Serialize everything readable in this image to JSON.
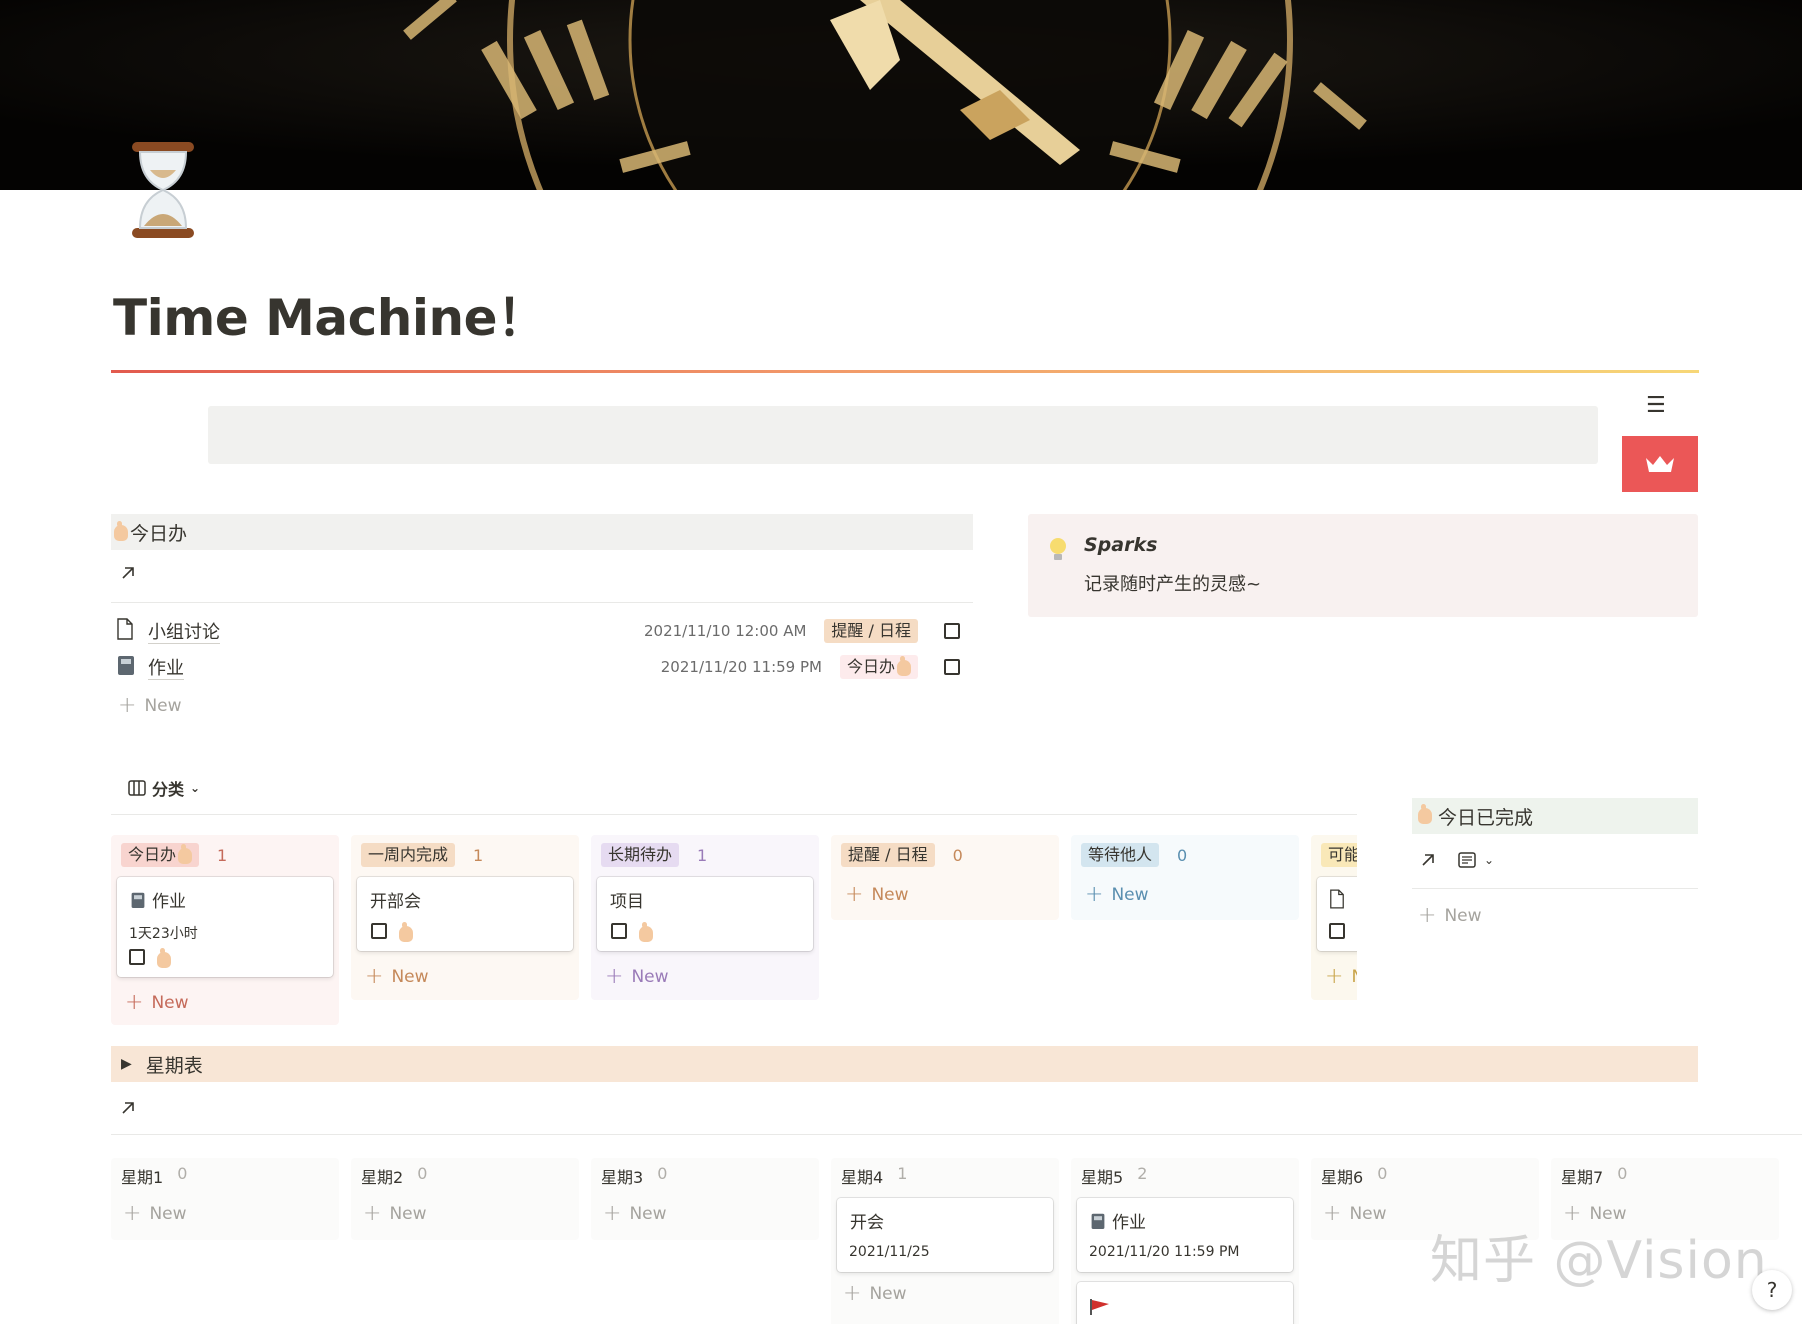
{
  "page": {
    "title": "Time Machine！"
  },
  "today_section": {
    "heading": "今日办",
    "rows": [
      {
        "title": "小组讨论",
        "date": "2021/11/10 12:00 AM",
        "tag": "提醒 / 日程"
      },
      {
        "title": "作业",
        "date": "2021/11/20 11:59 PM",
        "tag": "今日办"
      }
    ],
    "new_label": "New"
  },
  "callout": {
    "title": "Sparks",
    "text": "记录随时产生的灵感~"
  },
  "board": {
    "group_by_label": "分类",
    "columns": [
      {
        "label": "今日办",
        "count": "1",
        "color": "#fdebec",
        "tag_bg": "#f8d4cf",
        "card": {
          "title": "作业",
          "subtitle": "1天23小时"
        }
      },
      {
        "label": "一周内完成",
        "count": "1",
        "color": "#fbf3ec",
        "tag_bg": "#f5dcc4",
        "card": {
          "title": "开部会"
        }
      },
      {
        "label": "长期待办",
        "count": "1",
        "color": "#f7f4f9",
        "tag_bg": "#e6dbf1",
        "card": {
          "title": "项目"
        }
      },
      {
        "label": "提醒 / 日程",
        "count": "0",
        "color": "#fbf3ec",
        "tag_bg": "#f5dcc4"
      },
      {
        "label": "等待他人",
        "count": "0",
        "color": "#f3f8fb",
        "tag_bg": "#d3e5ef"
      },
      {
        "label": "可能",
        "count": "",
        "color": "#fbf6ea",
        "tag_bg": "#f9e8b8"
      }
    ],
    "new_label": "New"
  },
  "done_section": {
    "heading": "今日已完成",
    "new_label": "New"
  },
  "week_section": {
    "heading": "星期表",
    "columns": [
      {
        "label": "星期1",
        "count": "0"
      },
      {
        "label": "星期2",
        "count": "0"
      },
      {
        "label": "星期3",
        "count": "0"
      },
      {
        "label": "星期4",
        "count": "1",
        "card": {
          "title": "开会",
          "date": "2021/11/25"
        }
      },
      {
        "label": "星期5",
        "count": "2",
        "card": {
          "title": "作业",
          "date": "2021/11/20 11:59 PM"
        }
      },
      {
        "label": "星期6",
        "count": "0"
      },
      {
        "label": "星期7",
        "count": "0"
      }
    ],
    "new_label": "New"
  },
  "watermark": "知乎 @Vision",
  "help_label": "?"
}
